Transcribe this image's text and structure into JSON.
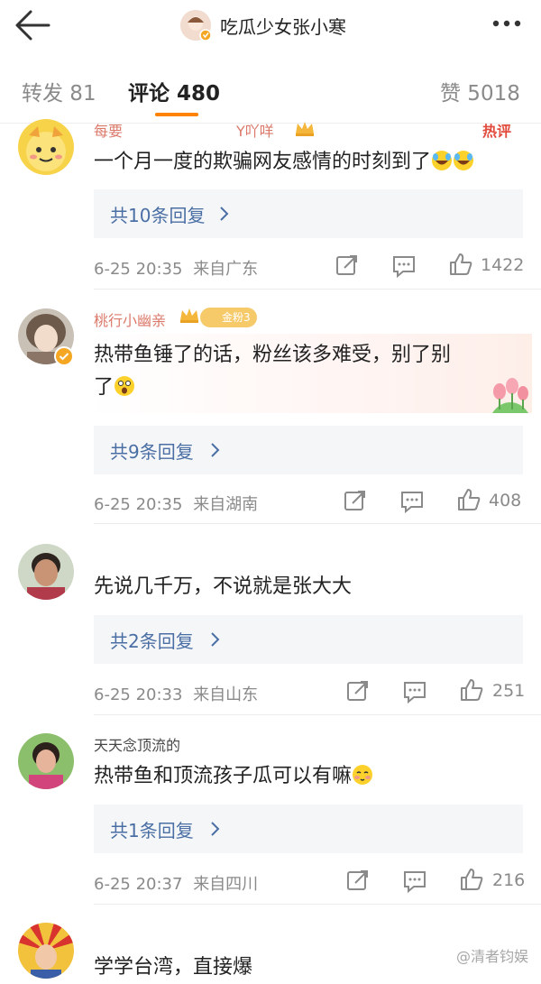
{
  "header": {
    "title": "吃瓜少女张小寒",
    "back_icon": "arrow-left-icon",
    "more_icon": "more-dots-icon"
  },
  "tabs": [
    {
      "label": "转发 81"
    },
    {
      "label": "评论 480"
    },
    {
      "label": "赞 5018"
    }
  ],
  "comments": [
    {
      "username": "每要",
      "username_extra": "Y吖咩",
      "text": "一个月一度的欺骗网友感情的时刻到了",
      "badge": "热评",
      "reply_label": "共10条回复",
      "time": "6-25 20:35",
      "location": "来自广东",
      "likes": "1422"
    },
    {
      "username": "桃行小幽亲",
      "text_line1": "热带鱼锤了的话，粉丝该多难受，别了别",
      "text_line2": "了",
      "fan_badge": "金粉3",
      "reply_label": "共9条回复",
      "time": "6-25 20:35",
      "location": "来自湖南",
      "likes": "408"
    },
    {
      "username": "",
      "text": "先说几千万，不说就是张大大",
      "reply_label": "共2条回复",
      "time": "6-25 20:33",
      "location": "来自山东",
      "likes": "251"
    },
    {
      "username": "天天念顶流的",
      "text": "热带鱼和顶流孩子瓜可以有嘛",
      "reply_label": "共1条回复",
      "time": "6-25 20:37",
      "location": "来自四川",
      "likes": "216"
    },
    {
      "username": "",
      "text": "学学台湾，直接爆"
    }
  ],
  "watermark": "@清者钧娱",
  "colors": {
    "accent_underline": "#ff8200",
    "reply_link": "#4a6fa5",
    "meta_gray": "#8a8a8a",
    "hot_badge": "#e24a3c"
  }
}
